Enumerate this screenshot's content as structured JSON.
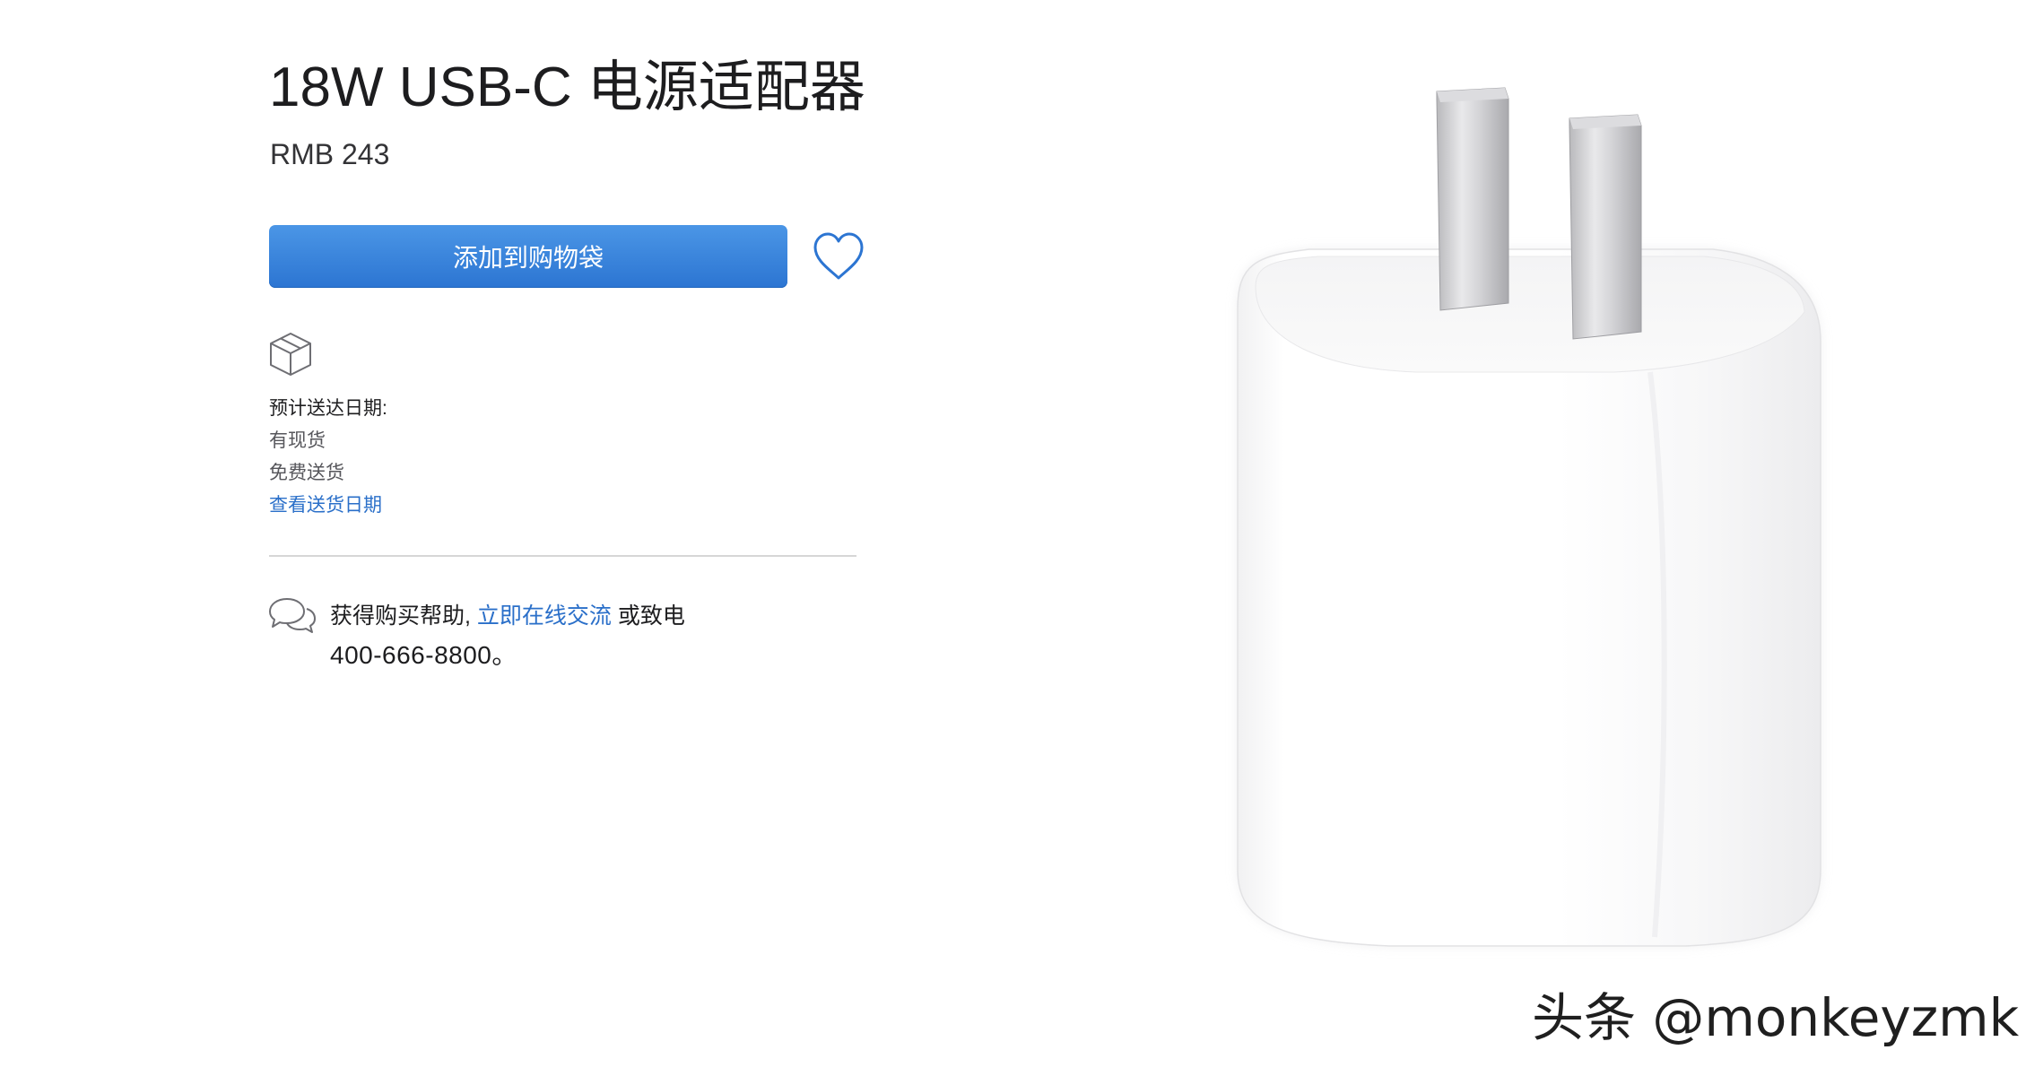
{
  "product": {
    "title": "18W USB-C 电源适配器",
    "price": "RMB 243"
  },
  "actions": {
    "add_to_bag_label": "添加到购物袋",
    "favorite_icon": "heart-icon"
  },
  "delivery": {
    "icon": "box-icon",
    "label": "预计送达日期:",
    "availability": "有现货",
    "shipping": "免费送货",
    "check_link": "查看送货日期"
  },
  "help": {
    "icon": "chat-bubbles-icon",
    "text_before": "获得购买帮助,",
    "chat_link": "立即在线交流",
    "text_after": "或致电",
    "phone": "400-666-8800。"
  },
  "image": {
    "subject": "usb-c-power-adapter"
  },
  "watermark": {
    "text": "头条 @monkeyzmk"
  },
  "colors": {
    "accent": "#2a6fc9",
    "button_top": "#4b96e6",
    "button_bottom": "#2c75d2",
    "text": "#1d1d1f"
  }
}
